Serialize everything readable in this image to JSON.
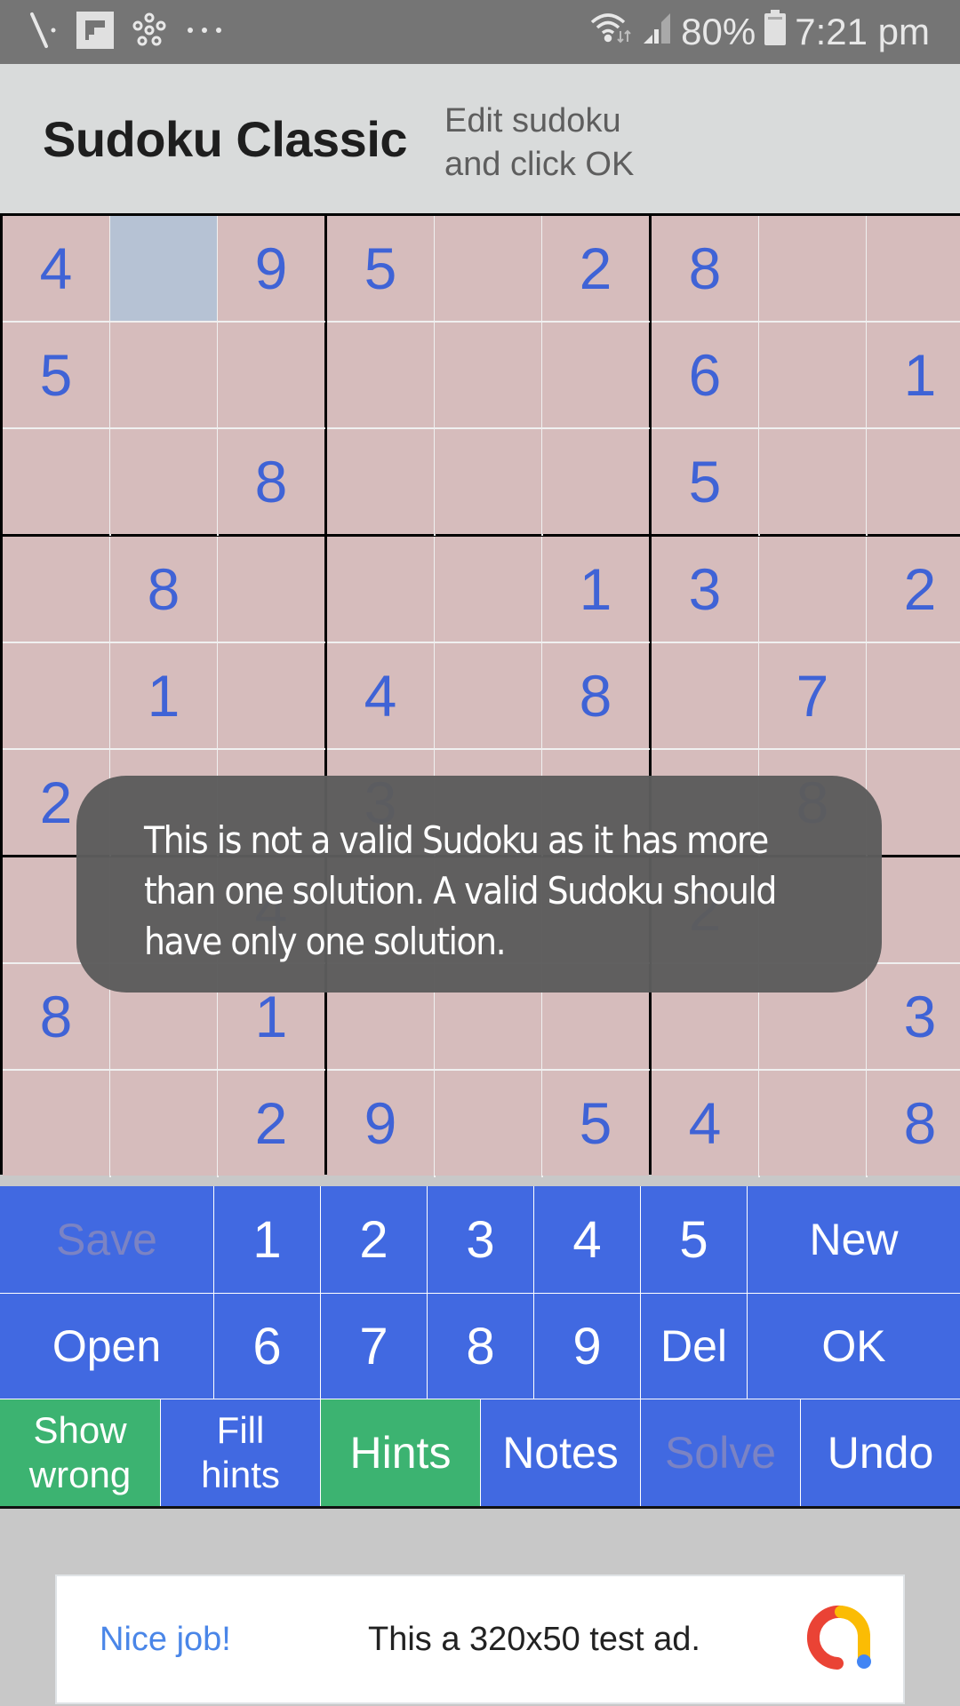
{
  "status_bar": {
    "left_icons": [
      "screwdriver-icon",
      "flipboard-icon",
      "network-hub-icon",
      "more-dots-icon"
    ],
    "battery_percent": "80%",
    "time": "7:21 pm",
    "right_icons": [
      "wifi-icon",
      "signal-icon",
      "battery-icon"
    ]
  },
  "app_bar": {
    "title": "Sudoku Classic",
    "subtitle": "Edit sudoku\nand click OK"
  },
  "grid": {
    "selected": [
      0,
      1
    ],
    "cells": [
      [
        "4",
        "",
        "9",
        "5",
        "",
        "2",
        "8",
        "",
        ""
      ],
      [
        "5",
        "",
        "",
        "",
        "",
        "",
        "6",
        "",
        "1"
      ],
      [
        "",
        "",
        "8",
        "",
        "",
        "",
        "5",
        "",
        ""
      ],
      [
        "",
        "8",
        "",
        "",
        "",
        "1",
        "3",
        "",
        "2"
      ],
      [
        "",
        "1",
        "",
        "4",
        "",
        "8",
        "",
        "7",
        ""
      ],
      [
        "2",
        "",
        "",
        "3",
        "",
        "",
        "",
        "8",
        ""
      ],
      [
        "",
        "",
        "4",
        "",
        "",
        "",
        "2",
        "",
        ""
      ],
      [
        "8",
        "",
        "1",
        "",
        "",
        "",
        "",
        "",
        "3"
      ],
      [
        "",
        "",
        "2",
        "9",
        "",
        "5",
        "4",
        "",
        "8"
      ]
    ]
  },
  "toast": {
    "message": "This is not a valid Sudoku as it has more than one solution. A valid Sudoku should have only one solution."
  },
  "keypad": {
    "row1": [
      {
        "label": "Save",
        "disabled": true
      },
      {
        "label": "1"
      },
      {
        "label": "2"
      },
      {
        "label": "3"
      },
      {
        "label": "4"
      },
      {
        "label": "5"
      },
      {
        "label": "New"
      }
    ],
    "row2": [
      {
        "label": "Open"
      },
      {
        "label": "6"
      },
      {
        "label": "7"
      },
      {
        "label": "8"
      },
      {
        "label": "9"
      },
      {
        "label": "Del"
      },
      {
        "label": "OK"
      }
    ],
    "row3": [
      {
        "label": "Show\nwrong",
        "active": true
      },
      {
        "label": "Fill\nhints"
      },
      {
        "label": "Hints",
        "active": true
      },
      {
        "label": "Notes"
      },
      {
        "label": "Solve",
        "disabled": true
      },
      {
        "label": "Undo"
      }
    ]
  },
  "colors": {
    "key_blue": "#4169e1",
    "key_green": "#3cb371",
    "cell_bg": "#d6bcbc",
    "cell_selected": "#b6c2d4",
    "digit_blue": "#3f63d6"
  },
  "ad": {
    "headline": "Nice job!",
    "text": "This a 320x50 test ad."
  }
}
